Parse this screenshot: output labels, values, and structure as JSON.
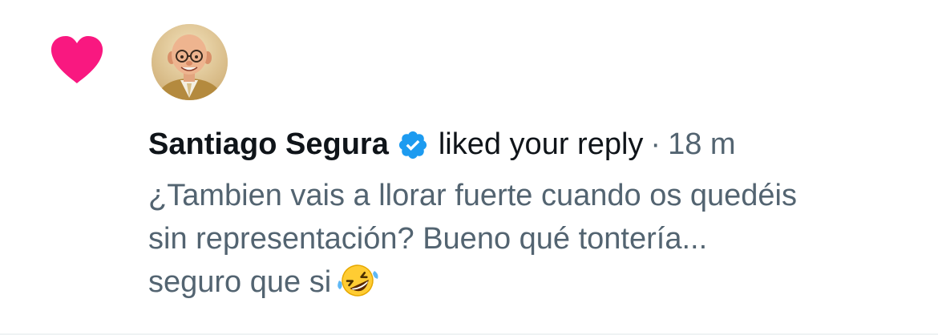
{
  "notification": {
    "type_icon": "heart-icon",
    "accent_color": "#f91880",
    "verified_color": "#1d9bf0",
    "avatar_icon": "avatar",
    "user": {
      "display_name": "Santiago Segura",
      "verified": true
    },
    "action": "liked your reply",
    "separator": "·",
    "time_ago": "18 m",
    "reply": {
      "line1": "¿Tambien vais a llorar fuerte cuando os quedéis",
      "line2": "sin representación? Bueno qué tontería...",
      "line3": "seguro que si",
      "emoji": "rolling-on-the-floor-laughing-emoji"
    }
  }
}
